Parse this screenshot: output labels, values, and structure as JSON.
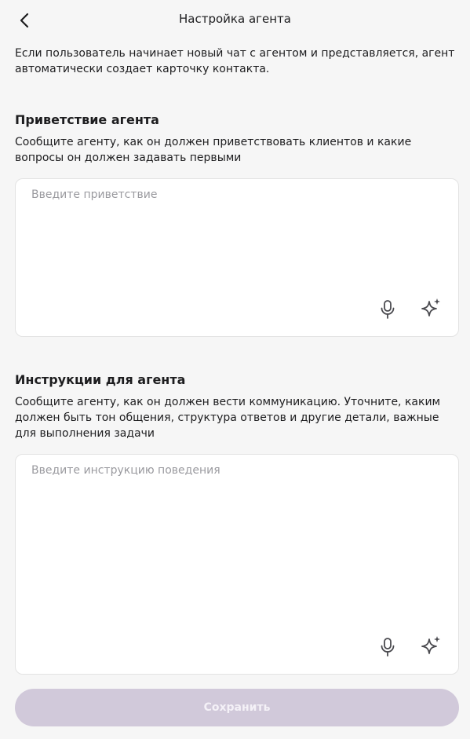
{
  "header": {
    "title": "Настройка агента",
    "back_icon": "chevron-left-icon"
  },
  "intro": {
    "text": "Если пользователь начинает новый чат с агентом и представляется, агент автоматически создает карточку контакта."
  },
  "greeting": {
    "title": "Приветствие агента",
    "description": "Сообщите агенту, как он должен приветствовать клиентов и какие вопросы он должен задавать первыми",
    "placeholder": "Введите приветствие",
    "value": "",
    "icons": [
      "microphone-icon",
      "sparkle-icon"
    ]
  },
  "instructions": {
    "title": "Инструкции для агента",
    "description": "Сообщите агенту, как он должен вести коммуникацию. Уточните, каким должен быть тон общения, структура ответов и другие детали, важные для выполнения задачи",
    "placeholder": "Введите инструкцию поведения",
    "value": "",
    "icons": [
      "microphone-icon",
      "sparkle-icon"
    ]
  },
  "footer": {
    "save_label": "Сохранить"
  },
  "colors": {
    "background": "#f6f6f6",
    "save_button_disabled": "#d1c9da",
    "placeholder": "#9a9a9f",
    "icon": "#4a4a4f"
  }
}
